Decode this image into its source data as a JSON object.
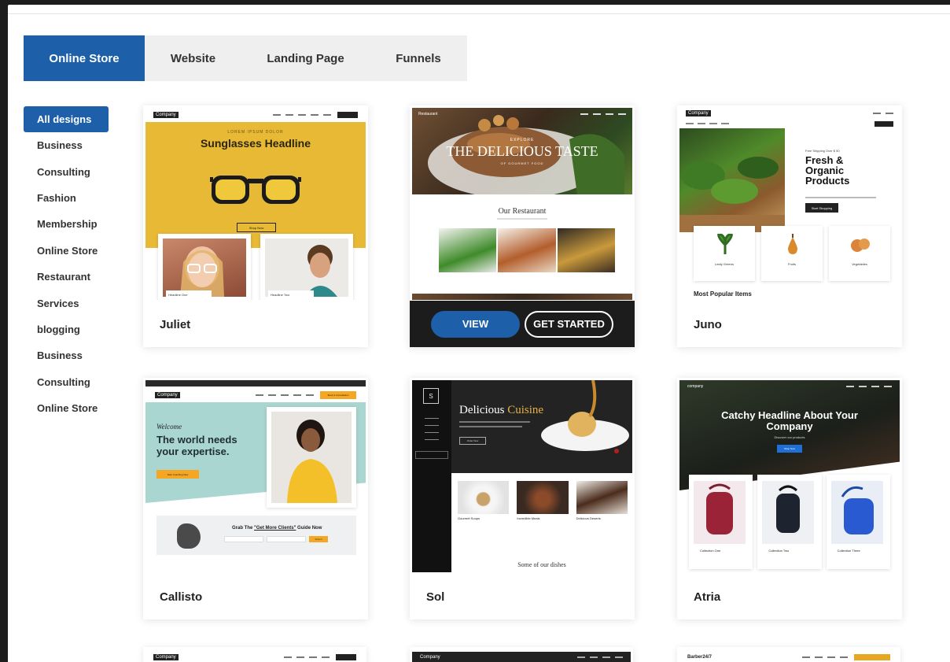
{
  "tabs": [
    {
      "label": "Online Store",
      "active": true
    },
    {
      "label": "Website",
      "active": false
    },
    {
      "label": "Landing Page",
      "active": false
    },
    {
      "label": "Funnels",
      "active": false
    }
  ],
  "sidebar": {
    "items": [
      {
        "label": "All designs",
        "active": true
      },
      {
        "label": "Business"
      },
      {
        "label": "Consulting"
      },
      {
        "label": "Fashion"
      },
      {
        "label": "Membership"
      },
      {
        "label": "Online Store"
      },
      {
        "label": "Restaurant"
      },
      {
        "label": "Services"
      },
      {
        "label": "blogging"
      },
      {
        "label": "Business"
      },
      {
        "label": "Consulting"
      },
      {
        "label": "Online Store"
      }
    ]
  },
  "cards": [
    {
      "name": "Juliet",
      "thumb": {
        "logo": "Company",
        "headline": "Sunglasses Headline",
        "tagline": "LOREM IPSUM DOLOR",
        "button": "Shop Now",
        "item1": "Headline One",
        "item2": "Headline Two"
      }
    },
    {
      "name": "",
      "thumb": {
        "logo": "Restaurant",
        "kicker": "EXPLORE",
        "headline": "THE DELICIOUS TASTE",
        "sub": "OF GOURMET FOOD",
        "section": "Our Restaurant"
      },
      "view_label": "VIEW",
      "start_label": "GET STARTED"
    },
    {
      "name": "Juno",
      "thumb": {
        "logo": "Company",
        "eyebrow": "Free Shipping Over $ 50",
        "headline": "Fresh & Organic Products",
        "button": "Start Shopping",
        "item1": "Leafy Greens",
        "item2": "Fruits",
        "item3": "Vegetables",
        "section": "Most Popular Items"
      }
    },
    {
      "name": "Callisto",
      "thumb": {
        "logo": "Company",
        "script": "Welcome",
        "headline1": "The world needs",
        "headline2": "your expertise.",
        "button": "Start Coaching Now",
        "cta_prefix": "Grab The ",
        "cta_link": "\"Get More Clients\"",
        "cta_suffix": " Guide Now",
        "cta_button": "Submit",
        "corner_button": "Book A Consultation"
      }
    },
    {
      "name": "Sol",
      "thumb": {
        "logo": "S",
        "headline1": "Delicious ",
        "headline2": "Cuisine",
        "button": "Order Now",
        "dish1": "Gourmet Soups",
        "dish2": "Incredible Meals",
        "dish3": "Delicious Deserts",
        "section": "Some of our dishes"
      }
    },
    {
      "name": "Atria",
      "thumb": {
        "logo": "company",
        "headline": "Catchy Headline About Your Company",
        "sub": "Discover our products",
        "button": "Shop Now",
        "item1": "Collection One",
        "item2": "Collection Two",
        "item3": "Collection Three"
      }
    }
  ],
  "peek": [
    {
      "logo": "Company"
    },
    {
      "logo": "Company"
    },
    {
      "logo": "Barber24/7"
    }
  ],
  "colors": {
    "accent": "#1d5fa8",
    "yellow": "#e8b935",
    "teal": "#a9d6d0",
    "dark": "#1c1c1c"
  }
}
